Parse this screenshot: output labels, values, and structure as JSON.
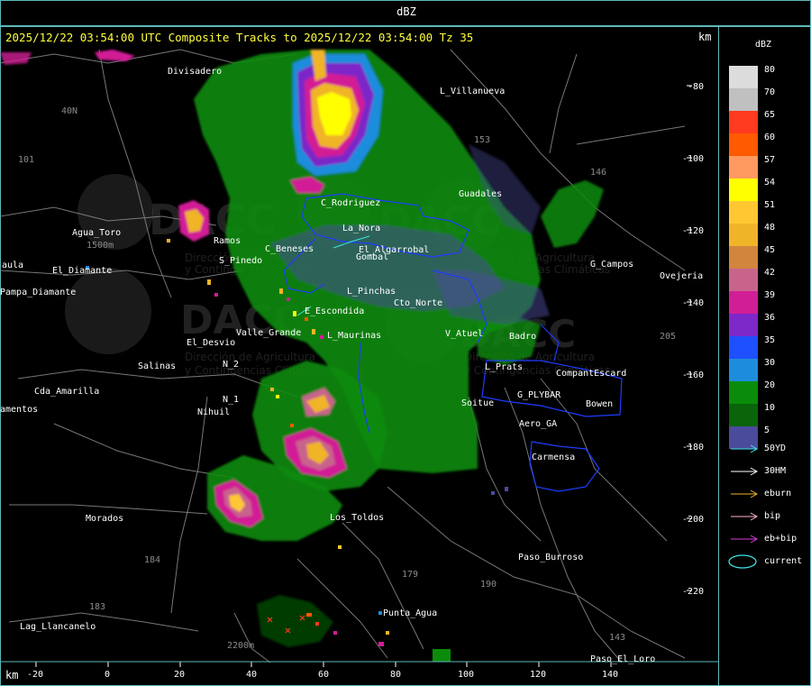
{
  "window_title": "dBZ",
  "header": {
    "text": "2025/12/22 03:54:00 UTC Composite Tracks to 2025/12/22 03:54:00 Tz 35",
    "unit_top": "km",
    "unit_bottom": "km"
  },
  "legend": {
    "title": "dBZ",
    "scale": [
      {
        "value": "80",
        "color": "#dcdcdc"
      },
      {
        "value": "70",
        "color": "#c0c0c0"
      },
      {
        "value": "65",
        "color": "#ff3a1e"
      },
      {
        "value": "60",
        "color": "#ff5a00"
      },
      {
        "value": "57",
        "color": "#ff9960"
      },
      {
        "value": "54",
        "color": "#ffff00"
      },
      {
        "value": "51",
        "color": "#ffc832"
      },
      {
        "value": "48",
        "color": "#f0b428"
      },
      {
        "value": "45",
        "color": "#d2853c"
      },
      {
        "value": "42",
        "color": "#c8648c"
      },
      {
        "value": "39",
        "color": "#d21e96"
      },
      {
        "value": "36",
        "color": "#7d28c8"
      },
      {
        "value": "35",
        "color": "#1e50ff"
      },
      {
        "value": "30",
        "color": "#1e8cdc"
      },
      {
        "value": "20",
        "color": "#0a8c0a"
      },
      {
        "value": "10",
        "color": "#0a640a"
      },
      {
        "value": "5",
        "color": "#4b4b9b"
      }
    ],
    "tracks": [
      {
        "label": "50YD",
        "color": "#3ce6e6"
      },
      {
        "label": "30HM",
        "color": "#ffffff"
      },
      {
        "label": "eburn",
        "color": "#f0b428"
      },
      {
        "label": "bip",
        "color": "#ffb4c8"
      },
      {
        "label": "eb+bip",
        "color": "#dc3cdc"
      }
    ],
    "current_label": "current",
    "current_color": "#3ce6e6"
  },
  "axes": {
    "x_ticks": [
      "-20",
      "0",
      "20",
      "40",
      "60",
      "80",
      "100",
      "120",
      "140"
    ],
    "y_ticks": [
      "-80",
      "-100",
      "-120",
      "-140",
      "-160",
      "-180",
      "-200",
      "-220"
    ]
  },
  "places": [
    "Divisadero",
    "L_Villanueva",
    "40N",
    "101",
    "153",
    "Guadales",
    "146",
    "G_Campos",
    "Ovejeria",
    "C_Rodriguez",
    "La_Nora",
    "Agua_Toro",
    "1500m",
    "Pampa_Diamante",
    "El_Diamante",
    "aula",
    "El_Algarrobal",
    "Gombal",
    "C_Beneses",
    "Ramos",
    "S_Pinedo",
    "L_Pinchas",
    "E_Escondida",
    "Cto_Norte",
    "V_Atuel",
    "Badro",
    "El_Desvio",
    "Valle_Grande",
    "L_Maurinas",
    "Salinas",
    "N_2",
    "L_Prats",
    "CompantEscard",
    "Cda_Amarilla",
    "amentos",
    "N_1",
    "Nihuil",
    "G_PLYBAR",
    "Bowen",
    "Soitue",
    "Aero_GA",
    "Carmensa",
    "Morados",
    "Los_Toldos",
    "Paso_Burroso",
    "179",
    "190",
    "184",
    "183",
    "Lag_Llancanelo",
    "Punta_Agua",
    "2200m",
    "143",
    "Paso_El_Loro",
    "205"
  ],
  "watermark": {
    "brand": "DACC",
    "line1": "Dirección de Agricultura",
    "line2": "y Contingencias Climáticas"
  }
}
